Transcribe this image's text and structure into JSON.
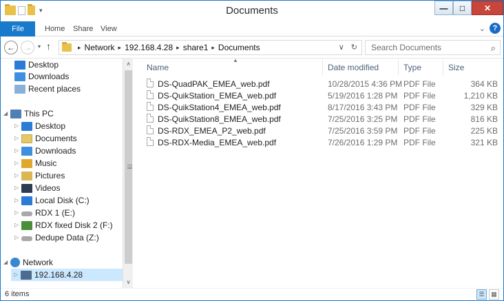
{
  "window": {
    "title": "Documents",
    "minimize_icon": "minimize-icon",
    "maximize_icon": "maximize-icon",
    "close_icon": "close-icon",
    "minimize_glyph": "—",
    "maximize_glyph": "□",
    "close_glyph": "✕"
  },
  "ribbon": {
    "tabs": [
      "File",
      "Home",
      "Share",
      "View"
    ],
    "expand_glyph": "⌄",
    "help_glyph": "?"
  },
  "address": {
    "back_glyph": "←",
    "forward_glyph": "→",
    "recent_glyph": "▾",
    "up_glyph": "↑",
    "crumbs": [
      "Network",
      "192.168.4.28",
      "share1",
      "Documents"
    ],
    "separator": "▸",
    "dropdown_glyph": "∨",
    "refresh_glyph": "↻"
  },
  "search": {
    "placeholder": "Search Documents",
    "icon_glyph": "⌕"
  },
  "nav_pane": {
    "top_items": [
      "Desktop",
      "Downloads",
      "Recent places"
    ],
    "this_pc": {
      "label": "This PC",
      "children": [
        "Desktop",
        "Documents",
        "Downloads",
        "Music",
        "Pictures",
        "Videos",
        "Local Disk (C:)",
        "RDX 1 (E:)",
        "RDX fixed Disk 2 (F:)",
        "Dedupe Data (Z:)"
      ]
    },
    "network": {
      "label": "Network",
      "children": [
        "192.168.4.28"
      ]
    },
    "expand_glyph": "▷",
    "collapse_glyph": "◢",
    "scroll_up_glyph": "∧",
    "scroll_down_glyph": "∨"
  },
  "file_list": {
    "sort_glyph": "▲",
    "columns": [
      "Name",
      "Date modified",
      "Type",
      "Size"
    ],
    "rows": [
      {
        "name": "DS-QuadPAK_EMEA_web.pdf",
        "date": "10/28/2015 4:36 PM",
        "type": "PDF File",
        "size": "364 KB"
      },
      {
        "name": "DS-QuikStation_EMEA_web.pdf",
        "date": "5/19/2016 1:28 PM",
        "type": "PDF File",
        "size": "1,210 KB"
      },
      {
        "name": "DS-QuikStation4_EMEA_web.pdf",
        "date": "8/17/2016 3:43 PM",
        "type": "PDF File",
        "size": "329 KB"
      },
      {
        "name": "DS-QuikStation8_EMEA_web.pdf",
        "date": "7/25/2016 3:25 PM",
        "type": "PDF File",
        "size": "816 KB"
      },
      {
        "name": "DS-RDX_EMEA_P2_web.pdf",
        "date": "7/25/2016 3:59 PM",
        "type": "PDF File",
        "size": "225 KB"
      },
      {
        "name": "DS-RDX-Media_EMEA_web.pdf",
        "date": "7/26/2016 1:29 PM",
        "type": "PDF File",
        "size": "321 KB"
      }
    ]
  },
  "status": {
    "item_count": "6 items",
    "details_view_glyph": "☰",
    "large_icons_glyph": "▦"
  }
}
